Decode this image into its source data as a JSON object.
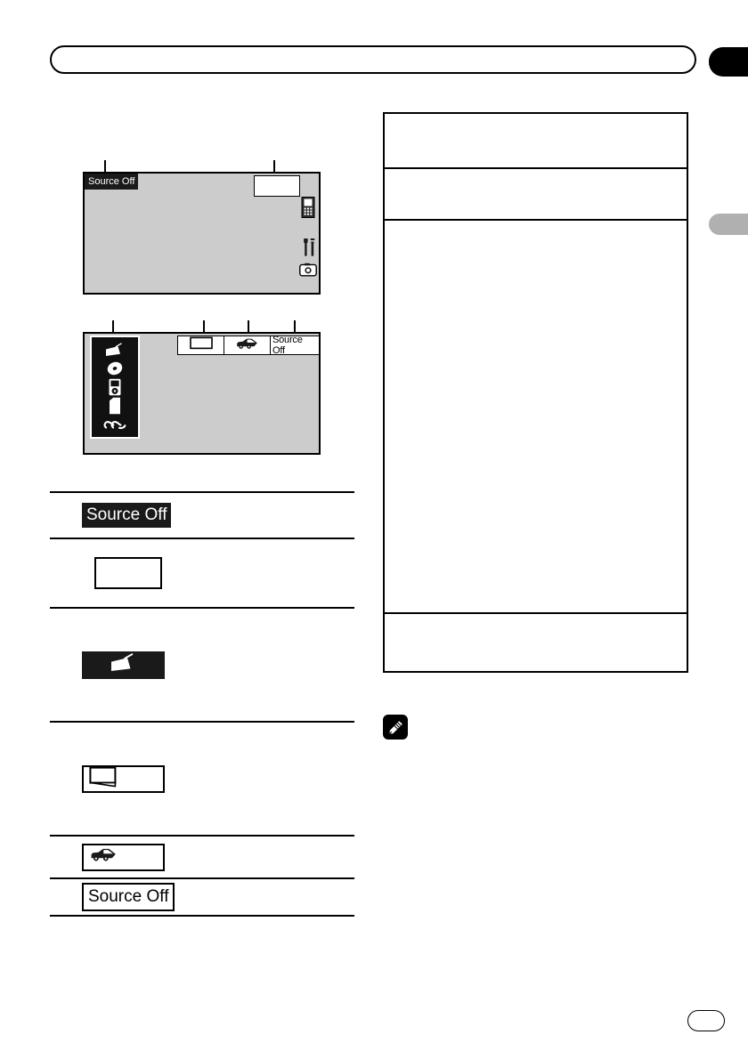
{
  "page": {
    "header_title": "",
    "page_number": "",
    "edge_tabs": [
      {
        "name": "chapter-tab-active",
        "color": "#000000"
      },
      {
        "name": "chapter-tab-inactive",
        "color": "#b0b0b0"
      }
    ]
  },
  "figures": [
    {
      "id": "display-source-off",
      "caption": "",
      "status_badge": "Source Off",
      "empty_field": "",
      "status_icons": [
        {
          "name": "remote-control-icon",
          "label": ""
        },
        {
          "name": "tools-icon",
          "label": ""
        },
        {
          "name": "camera-icon",
          "label": ""
        }
      ],
      "callouts": [
        {
          "index": "",
          "target": "status-badge"
        },
        {
          "index": "",
          "target": "empty-field"
        }
      ]
    },
    {
      "id": "display-source-menu",
      "caption": "",
      "source_list": [
        {
          "name": "radio-icon",
          "label": ""
        },
        {
          "name": "disc-icon",
          "label": ""
        },
        {
          "name": "ipod-icon",
          "label": ""
        },
        {
          "name": "sd-card-icon",
          "label": ""
        },
        {
          "name": "aux-link-icon",
          "label": ""
        }
      ],
      "topbar_cells": [
        {
          "name": "display-screen-icon",
          "text": ""
        },
        {
          "name": "car-icon",
          "text": ""
        },
        {
          "name": "source-off-label",
          "text": "Source Off"
        }
      ],
      "callouts": [
        {
          "index": "",
          "target": "source-panel"
        },
        {
          "index": "",
          "target": "display-screen-icon"
        },
        {
          "index": "",
          "target": "car-icon"
        },
        {
          "index": "",
          "target": "source-off-label"
        }
      ]
    }
  ],
  "legend": {
    "rows": [
      {
        "key_type": "chip-dark",
        "key_label": "Source Off",
        "description": ""
      },
      {
        "key_type": "box-empty",
        "key_label": "",
        "description": ""
      },
      {
        "key_type": "box-dark-icon",
        "key_icon": "radio-icon",
        "key_label": "",
        "description": ""
      },
      {
        "key_type": "box-outline-icon",
        "key_icon": "display-screen-icon",
        "key_label": "",
        "description": ""
      },
      {
        "key_type": "box-outline-icon",
        "key_icon": "car-icon",
        "key_label": "",
        "description": ""
      },
      {
        "key_type": "chip-outline",
        "key_label": "Source Off",
        "description": ""
      }
    ]
  },
  "info_table": {
    "rows": [
      {
        "text": ""
      },
      {
        "text": ""
      },
      {
        "text": ""
      },
      {
        "text": ""
      }
    ]
  },
  "note": {
    "icon": "note-pencil-icon",
    "text": ""
  },
  "colors": {
    "display_background": "#cccccc",
    "badge_dark": "#1a1a1a",
    "rule": "#000000",
    "tab_inactive": "#b0b0b0"
  }
}
